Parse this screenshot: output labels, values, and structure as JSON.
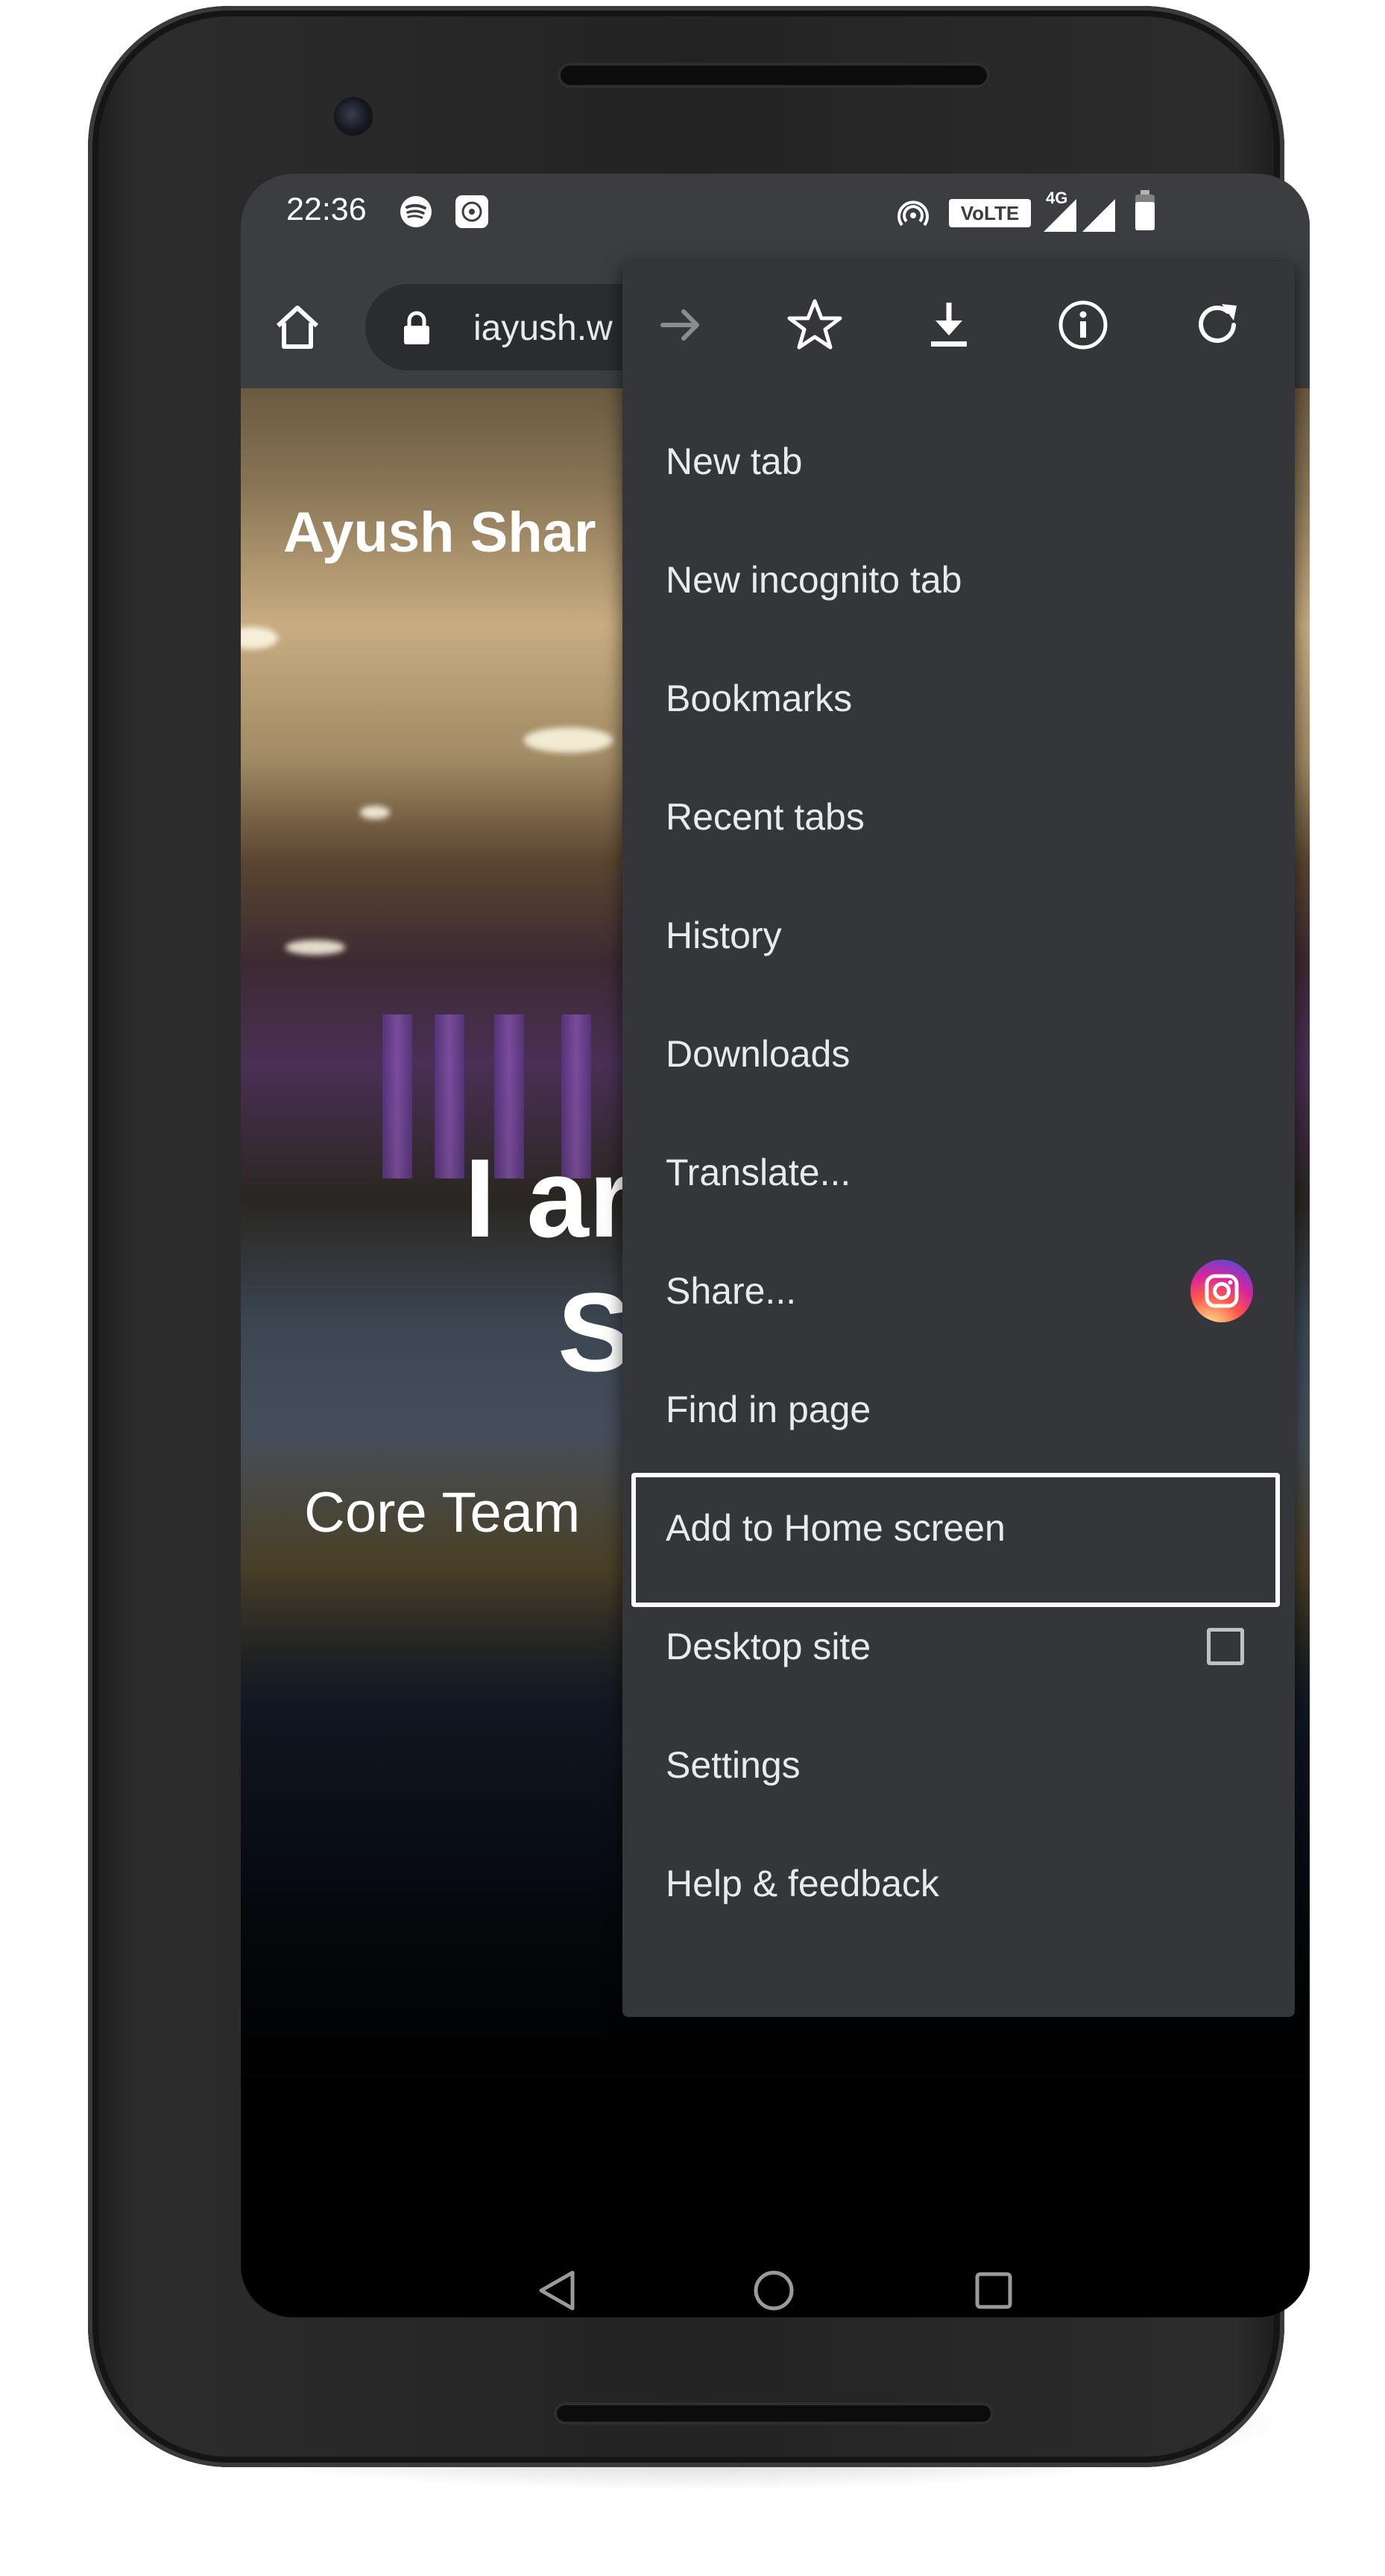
{
  "status_bar": {
    "time": "22:36",
    "left_icons": [
      "spotify-icon",
      "app-notification-icon"
    ],
    "right_icons": [
      "hotspot-icon",
      "volte-icon",
      "4g-data-icon",
      "signal-icon",
      "battery-icon"
    ],
    "volte_label": "VoLTE",
    "network_label": "4G"
  },
  "toolbar": {
    "url": "iayush.w"
  },
  "webpage": {
    "site_title": "Ayush Shar",
    "heading_line1": "I ar",
    "heading_line2": "S",
    "subtitle": "Core Team"
  },
  "menu": {
    "top_icons": [
      "forward-icon",
      "bookmark-star-icon",
      "download-icon",
      "info-icon",
      "reload-icon"
    ],
    "items": [
      {
        "label": "New tab"
      },
      {
        "label": "New incognito tab"
      },
      {
        "label": "Bookmarks"
      },
      {
        "label": "Recent tabs"
      },
      {
        "label": "History"
      },
      {
        "label": "Downloads"
      },
      {
        "label": "Translate..."
      },
      {
        "label": "Share..."
      },
      {
        "label": "Find in page"
      },
      {
        "label": "Add to Home screen"
      },
      {
        "label": "Desktop site"
      },
      {
        "label": "Settings"
      },
      {
        "label": "Help & feedback"
      }
    ],
    "highlighted_item": "Add to Home screen",
    "desktop_site_checked": false
  },
  "nav_bar": {
    "buttons": [
      "back-icon",
      "home-circle-icon",
      "recents-icon"
    ]
  },
  "colors": {
    "menu_bg": "#35363a",
    "toolbar_bg": "#3b3d40",
    "text": "#e8eaed",
    "highlight_border": "#ffffff"
  }
}
